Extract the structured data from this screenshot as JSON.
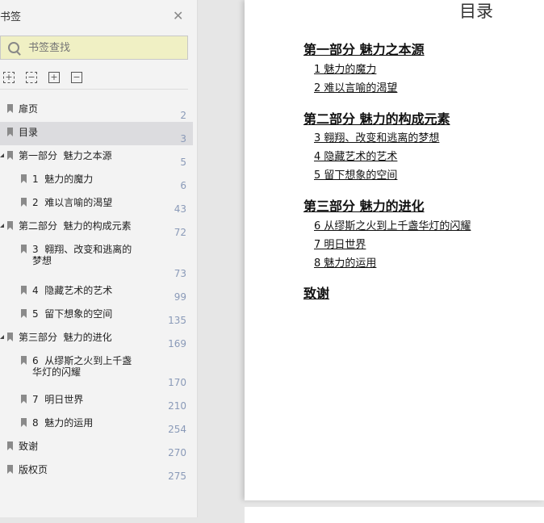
{
  "sidebar": {
    "title": "书签",
    "search_placeholder": "书签查找",
    "items": [
      {
        "label": "扉页",
        "page": "2"
      },
      {
        "label": "目录",
        "page": "3"
      },
      {
        "label": "第一部分  魅力之本源",
        "page": "5"
      },
      {
        "label": "1  魅力的魔力",
        "page": "6"
      },
      {
        "label": "2  难以言喻的渴望",
        "page": "43"
      },
      {
        "label": "第二部分  魅力的构成元素",
        "page": "72"
      },
      {
        "label": "3  翱翔、改变和逃离的\n梦想",
        "page": "73"
      },
      {
        "label": "4  隐藏艺术的艺术",
        "page": "99"
      },
      {
        "label": "5  留下想象的空间",
        "page": "135"
      },
      {
        "label": "第三部分  魅力的进化",
        "page": "169"
      },
      {
        "label": "6  从缪斯之火到上千盏\n华灯的闪耀",
        "page": "170"
      },
      {
        "label": "7  明日世界",
        "page": "210"
      },
      {
        "label": "8  魅力的运用",
        "page": "254"
      },
      {
        "label": "致谢",
        "page": "270"
      },
      {
        "label": "版权页",
        "page": "275"
      }
    ]
  },
  "document": {
    "title": "目录",
    "entries": [
      {
        "text": "第一部分 魅力之本源"
      },
      {
        "text": "1 魅力的魔力"
      },
      {
        "text": "2 难以言喻的渴望"
      },
      {
        "text": "第二部分 魅力的构成元素"
      },
      {
        "text": "3 翱翔、改变和逃离的梦想"
      },
      {
        "text": "4 隐藏艺术的艺术"
      },
      {
        "text": "5 留下想象的空间"
      },
      {
        "text": "第三部分 魅力的进化"
      },
      {
        "text": "6 从缪斯之火到上千盏华灯的闪耀"
      },
      {
        "text": "7 明日世界"
      },
      {
        "text": "8 魅力的运用"
      },
      {
        "text": "致谢"
      }
    ]
  }
}
